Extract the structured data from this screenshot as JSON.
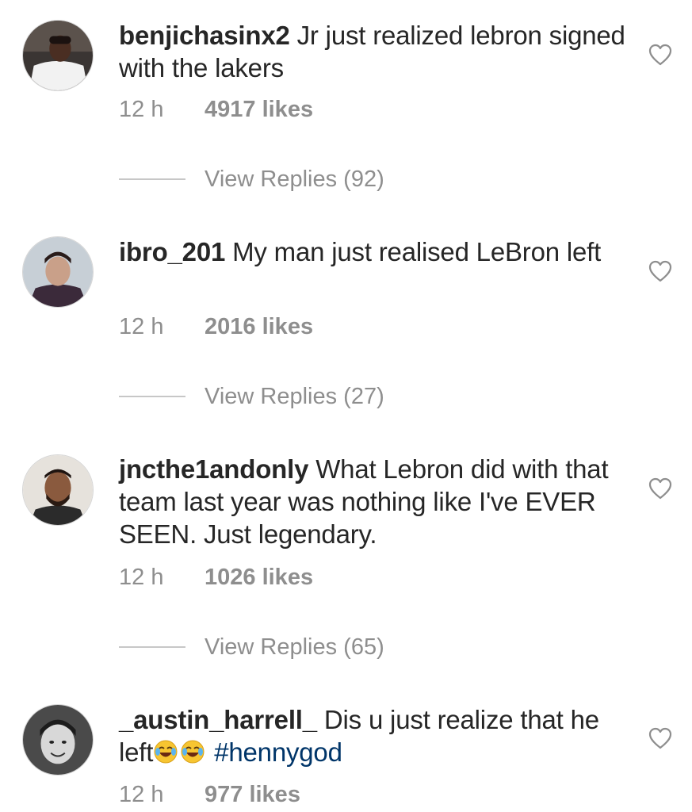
{
  "comments": [
    {
      "username": "benjichasinx2",
      "text_before": " Jr just realized lebron signed with the lakers",
      "emojis": [],
      "hashtag": "",
      "time": "12 h",
      "likes": "4917 likes",
      "replies": "View Replies (92)",
      "like_icon": "heart-outline-icon"
    },
    {
      "username": "ibro_201",
      "text_before": " My man just realised LeBron left",
      "emojis": [],
      "hashtag": "",
      "time": "12 h",
      "likes": "2016 likes",
      "replies": "View Replies (27)",
      "like_icon": "heart-outline-icon"
    },
    {
      "username": "jncthe1andonly",
      "text_before": " What Lebron did with that team last year was nothing like I've EVER SEEN. Just legendary.",
      "emojis": [],
      "hashtag": "",
      "time": "12 h",
      "likes": "1026 likes",
      "replies": "View Replies (65)",
      "like_icon": "heart-outline-icon"
    },
    {
      "username": "_austin_harrell_",
      "text_before": " Dis u just realize that he left",
      "emojis": [
        "😂",
        "😂"
      ],
      "hashtag": " #hennygod",
      "time": "12 h",
      "likes": "977 likes",
      "replies": "",
      "like_icon": "heart-outline-icon"
    }
  ],
  "colors": {
    "text": "#262626",
    "muted": "#8e8e8e",
    "hashtag": "#003569",
    "divider": "#c7c7c7"
  }
}
